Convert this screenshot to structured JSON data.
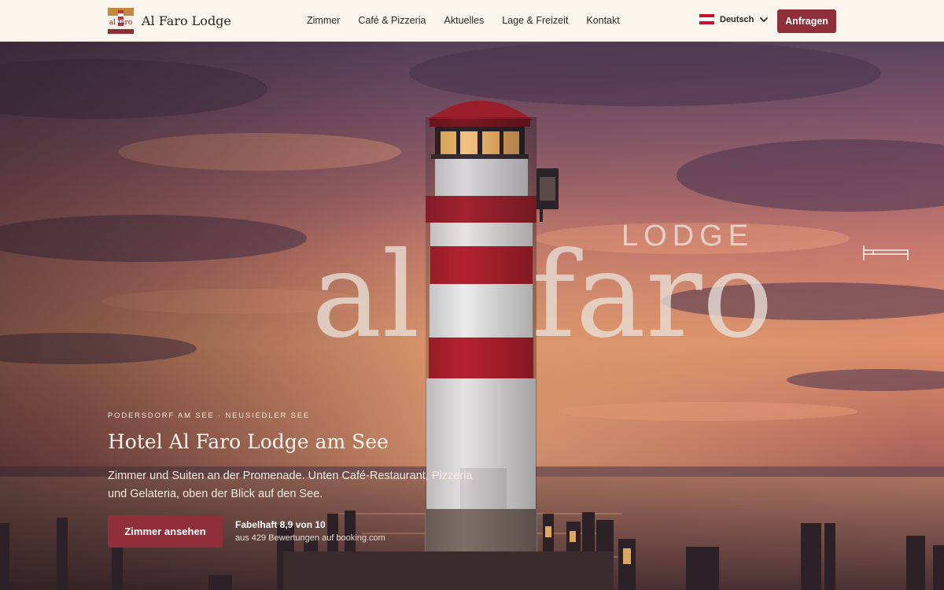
{
  "header": {
    "brand": {
      "logo_text": "al faro",
      "name": "Al Faro Lodge"
    },
    "nav": [
      "Zimmer",
      "Café & Pizzeria",
      "Aktuelles",
      "Lage & Freizeit",
      "Kontakt"
    ],
    "language": {
      "label": "Deutsch",
      "flag": "austria-flag-icon"
    },
    "cta_label": "Anfragen"
  },
  "hero": {
    "watermark": {
      "al": "al",
      "faro": "faro",
      "lodge": "LODGE"
    },
    "kicker": "PODERSDORF AM SEE · NEUSIEDLER SEE",
    "title": "Hotel Al Faro Lodge am See",
    "lede": "Zimmer und Suiten an der Promenade. Unten Café-Restaurant, Pizzeria und Gelateria, oben der Blick auf den See.",
    "button_label": "Zimmer ansehen",
    "rating": {
      "title": "Fabelhaft 8,9 von 10",
      "subtitle": "aus 429 Bewertungen auf booking.com"
    }
  },
  "colors": {
    "accent": "#8e2f3a",
    "header_bg": "#faf6ee",
    "text_dark": "#2b2622"
  }
}
